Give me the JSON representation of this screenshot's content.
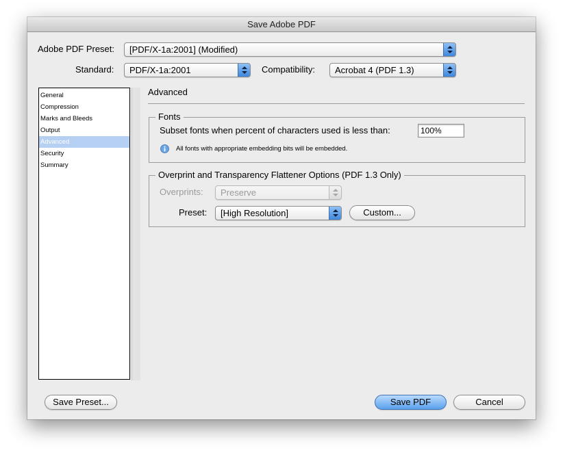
{
  "window": {
    "title": "Save Adobe PDF"
  },
  "preset": {
    "label": "Adobe PDF Preset:",
    "value": "[PDF/X-1a:2001] (Modified)"
  },
  "standard": {
    "label": "Standard:",
    "value": "PDF/X-1a:2001"
  },
  "compatibility": {
    "label": "Compatibility:",
    "value": "Acrobat 4 (PDF 1.3)"
  },
  "sidebar": {
    "items": [
      {
        "label": "General"
      },
      {
        "label": "Compression"
      },
      {
        "label": "Marks and Bleeds"
      },
      {
        "label": "Output"
      },
      {
        "label": "Advanced",
        "selected": true
      },
      {
        "label": "Security"
      },
      {
        "label": "Summary"
      }
    ]
  },
  "panel": {
    "title": "Advanced",
    "fonts": {
      "title": "Fonts",
      "subset_label": "Subset fonts when percent of characters used is less than:",
      "subset_value": "100%",
      "note": "All fonts with appropriate embedding bits will be embedded."
    },
    "overprint": {
      "title": "Overprint and Transparency Flattener Options (PDF 1.3 Only)",
      "overprints_label": "Overprints:",
      "overprints_value": "Preserve",
      "preset_label": "Preset:",
      "preset_value": "[High Resolution]",
      "custom_button": "Custom..."
    }
  },
  "buttons": {
    "save_preset": "Save Preset...",
    "save_pdf": "Save PDF",
    "cancel": "Cancel"
  },
  "colors": {
    "accent": "#5aa1ec",
    "selection": "#b5d0f3",
    "window_bg": "#ececec"
  }
}
